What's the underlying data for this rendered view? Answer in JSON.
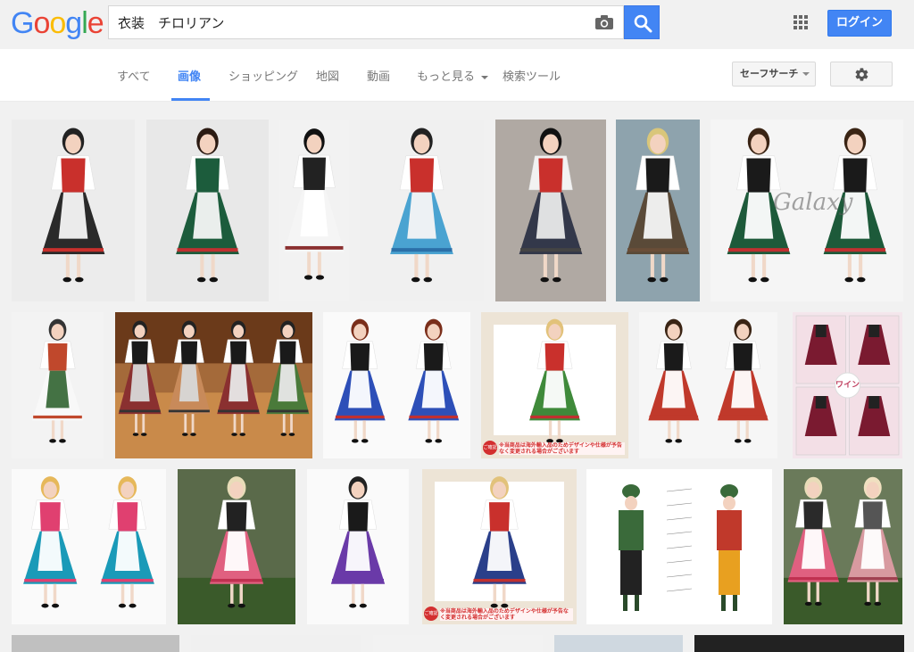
{
  "logo": {
    "letters": [
      "G",
      "o",
      "o",
      "g",
      "l",
      "e"
    ],
    "colors": [
      "#4285f4",
      "#ea4335",
      "#fbbc05",
      "#4285f4",
      "#34a853",
      "#ea4335"
    ]
  },
  "search": {
    "query": "衣装　チロリアン"
  },
  "header": {
    "login_label": "ログイン"
  },
  "tabs": [
    {
      "label": "すべて"
    },
    {
      "label": "画像"
    },
    {
      "label": "ショッピング"
    },
    {
      "label": "地図"
    },
    {
      "label": "動画"
    },
    {
      "label": "もっと見る"
    },
    {
      "label": "検索ツール"
    }
  ],
  "safesearch": {
    "label": "セーフサーチ"
  },
  "results": {
    "watermark": "Galaxy",
    "wine_label": "ワイン",
    "notice_1": "※当商品は海外輸入品のためデザインや仕様が予告なく変更される場合がございます",
    "notice_badge": "ご確認",
    "rows": [
      [
        {
          "bg": "#ececec",
          "dresses": [
            {
              "skirt": "#2a2a2a",
              "vest": "#c9302c",
              "apron": "#f5f5f5",
              "blouse": "#ffffff",
              "trim": "#c9302c",
              "hair": "#222"
            }
          ]
        },
        {
          "bg": "#e8e8e8",
          "dresses": [
            {
              "skirt": "#1c5c3c",
              "vest": "#1c5c3c",
              "apron": "#f5f5f5",
              "blouse": "#ffffff",
              "trim": "#c03030",
              "hair": "#2b1a12"
            }
          ]
        },
        {
          "bg": "#f2f2f2",
          "dresses": [
            {
              "skirt": "#f5f5f5",
              "vest": "#222222",
              "apron": "#ffffff",
              "blouse": "#ffffff",
              "trim": "#8b3030",
              "hair": "#111"
            }
          ]
        },
        {
          "bg": "#f0f0f0",
          "dresses": [
            {
              "skirt": "#4aa3d1",
              "vest": "#c9302c",
              "apron": "#f5f5f5",
              "blouse": "#ffffff",
              "trim": "#2b6fa8",
              "hair": "#222"
            }
          ]
        },
        {
          "bg": "#b0a9a3",
          "dresses": [
            {
              "skirt": "#33384a",
              "vest": "#c9302c",
              "apron": "#e9e9e9",
              "blouse": "#f2f2f2",
              "trim": "#444",
              "hair": "#111"
            }
          ]
        },
        {
          "bg": "#8ea3ad",
          "dresses": [
            {
              "skirt": "#5a4a38",
              "vest": "#1a1a1a",
              "apron": "#f5f5f5",
              "blouse": "#ffffff",
              "trim": "#6a4e38",
              "hair": "#d9c67a"
            }
          ]
        },
        {
          "bg": "#f5f5f5",
          "dresses": [
            {
              "skirt": "#1d5a3a",
              "vest": "#1a1a1a",
              "apron": "#ffffff",
              "blouse": "#ffffff",
              "trim": "#c03030",
              "hair": "#3a2414"
            },
            {
              "skirt": "#1d5a3a",
              "vest": "#1a1a1a",
              "apron": "#ffffff",
              "blouse": "#ffffff",
              "trim": "#c03030",
              "hair": "#3a2414"
            }
          ]
        }
      ],
      [
        {
          "bg": "#f3f3f3",
          "dresses": [
            {
              "skirt": "#f8f8f8",
              "vest": "#c0482c",
              "apron": "#3a6a3a",
              "blouse": "#ffffff",
              "trim": "#c0482c",
              "hair": "#333"
            }
          ]
        },
        {
          "bg": "#a46a3a",
          "dresses": [
            {
              "skirt": "#8a3030",
              "vest": "#1a1a1a",
              "apron": "#d8d8d8",
              "blouse": "#fff",
              "trim": "#333",
              "hair": "#222"
            },
            {
              "skirt": "#c88a5a",
              "vest": "#1a1a1a",
              "apron": "#d8d8d8",
              "blouse": "#fff",
              "trim": "#333",
              "hair": "#222"
            },
            {
              "skirt": "#8a3030",
              "vest": "#1a1a1a",
              "apron": "#e8e8e8",
              "blouse": "#fff",
              "trim": "#333",
              "hair": "#222"
            },
            {
              "skirt": "#4a7a3a",
              "vest": "#1a1a1a",
              "apron": "#e8e8e8",
              "blouse": "#fff",
              "trim": "#333",
              "hair": "#222"
            }
          ]
        },
        {
          "bg": "#fafafa",
          "dresses": [
            {
              "skirt": "#2d4fb8",
              "vest": "#1a1a1a",
              "apron": "#ffffff",
              "blouse": "#ffffff",
              "trim": "#c03030",
              "hair": "#7a2e1a"
            },
            {
              "skirt": "#2d4fb8",
              "vest": "#1a1a1a",
              "apron": "#ffffff",
              "blouse": "#ffffff",
              "trim": "#c03030",
              "hair": "#7a2e1a"
            }
          ]
        },
        {
          "bg": "#ede4d6",
          "dresses": [
            {
              "skirt": "#3f8a3a",
              "vest": "#c9302c",
              "apron": "#ffffff",
              "blouse": "#ffffff",
              "trim": "#c03030",
              "hair": "#e2c27a"
            }
          ]
        },
        {
          "bg": "#f6f6f6",
          "dresses": [
            {
              "skirt": "#c0392b",
              "vest": "#1a1a1a",
              "apron": "#ffffff",
              "blouse": "#ffffff",
              "trim": "#c0392b",
              "hair": "#3a2414"
            },
            {
              "skirt": "#c0392b",
              "vest": "#1a1a1a",
              "apron": "#ffffff",
              "blouse": "#ffffff",
              "trim": "#c0392b",
              "hair": "#3a2414"
            }
          ]
        },
        {
          "bg": "#f4e6ec",
          "dresses": []
        }
      ],
      [
        {
          "bg": "#fafafa",
          "dresses": [
            {
              "skirt": "#1a9ab8",
              "vest": "#e04070",
              "apron": "#ffffff",
              "blouse": "#ffffff",
              "trim": "#e04070",
              "hair": "#e6b85a"
            },
            {
              "skirt": "#1a9ab8",
              "vest": "#e04070",
              "apron": "#ffffff",
              "blouse": "#ffffff",
              "trim": "#e04070",
              "hair": "#e6b85a"
            }
          ]
        },
        {
          "bg": "#5a6a4a",
          "dresses": [
            {
              "skirt": "#e06080",
              "vest": "#222",
              "apron": "#ffffff",
              "blouse": "#ffffff",
              "trim": "#c03050",
              "hair": "#e8dcb8"
            }
          ]
        },
        {
          "bg": "#fafafa",
          "dresses": [
            {
              "skirt": "#6a3aa8",
              "vest": "#1a1a1a",
              "apron": "#ffffff",
              "blouse": "#ffffff",
              "trim": "#6a3aa8",
              "hair": "#222"
            }
          ]
        },
        {
          "bg": "#ede4d6",
          "dresses": [
            {
              "skirt": "#2a3f8a",
              "vest": "#c9302c",
              "apron": "#ffffff",
              "blouse": "#ffffff",
              "trim": "#c03030",
              "hair": "#e2c27a"
            }
          ]
        },
        {
          "bg": "#ffffff",
          "dresses": []
        },
        {
          "bg": "#6a7a5a",
          "dresses": [
            {
              "skirt": "#e06080",
              "vest": "#2a2a2a",
              "apron": "#ffffff",
              "blouse": "#ffffff",
              "trim": "#c03050",
              "hair": "#e8dcb8"
            },
            {
              "skirt": "#d89aa0",
              "vest": "#555",
              "apron": "#ffffff",
              "blouse": "#ffffff",
              "trim": "#a04050",
              "hair": "#f0e0c0"
            }
          ]
        }
      ],
      [
        {
          "bg": "#c0c0c0",
          "dresses": []
        },
        {
          "bg": "#f0f0f0",
          "dresses": []
        },
        {
          "bg": "#f2f2f2",
          "dresses": []
        },
        {
          "bg": "#cfd8e0",
          "dresses": []
        },
        {
          "bg": "#222222",
          "dresses": []
        }
      ]
    ]
  }
}
